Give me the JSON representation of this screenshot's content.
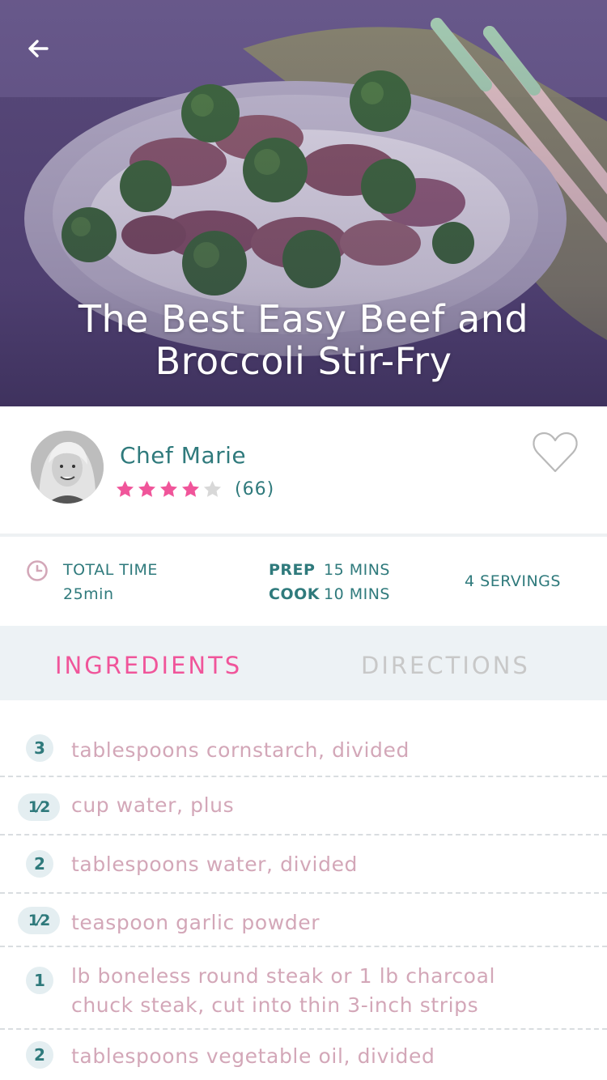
{
  "header": {
    "back_icon": "arrow-left-icon",
    "title": "The Best Easy Beef and Broccoli Stir-Fry"
  },
  "chef": {
    "name": "Chef Marie",
    "rating": 4,
    "rating_max": 5,
    "review_count": "(66)",
    "favorite_icon": "heart-outline-icon"
  },
  "timing": {
    "total_label": "TOTAL TIME",
    "total_value": "25min",
    "prep_label": "PREP",
    "prep_value": "15 MINS",
    "cook_label": "COOK",
    "cook_value": "10 MINS",
    "servings": "4 SERVINGS"
  },
  "tabs": [
    {
      "label": "INGREDIENTS",
      "active": true
    },
    {
      "label": "DIRECTIONS",
      "active": false
    }
  ],
  "ingredients": [
    {
      "qty": "3",
      "text": "tablespoons cornstarch, divided"
    },
    {
      "qty": "1⁄2",
      "text": "cup water, plus"
    },
    {
      "qty": "2",
      "text": "tablespoons water, divided"
    },
    {
      "qty": "1⁄2",
      "text": "teaspoon garlic powder"
    },
    {
      "qty": "1",
      "text": "lb boneless round steak or 1 lb charcoal chuck steak, cut into thin 3-inch strips"
    },
    {
      "qty": "2",
      "text": "tablespoons vegetable oil, divided"
    }
  ],
  "colors": {
    "accent_pink": "#f0559a",
    "teal": "#2f7a7c",
    "ingredient_text": "#d3a7b8",
    "tab_bg": "#edf2f5"
  }
}
